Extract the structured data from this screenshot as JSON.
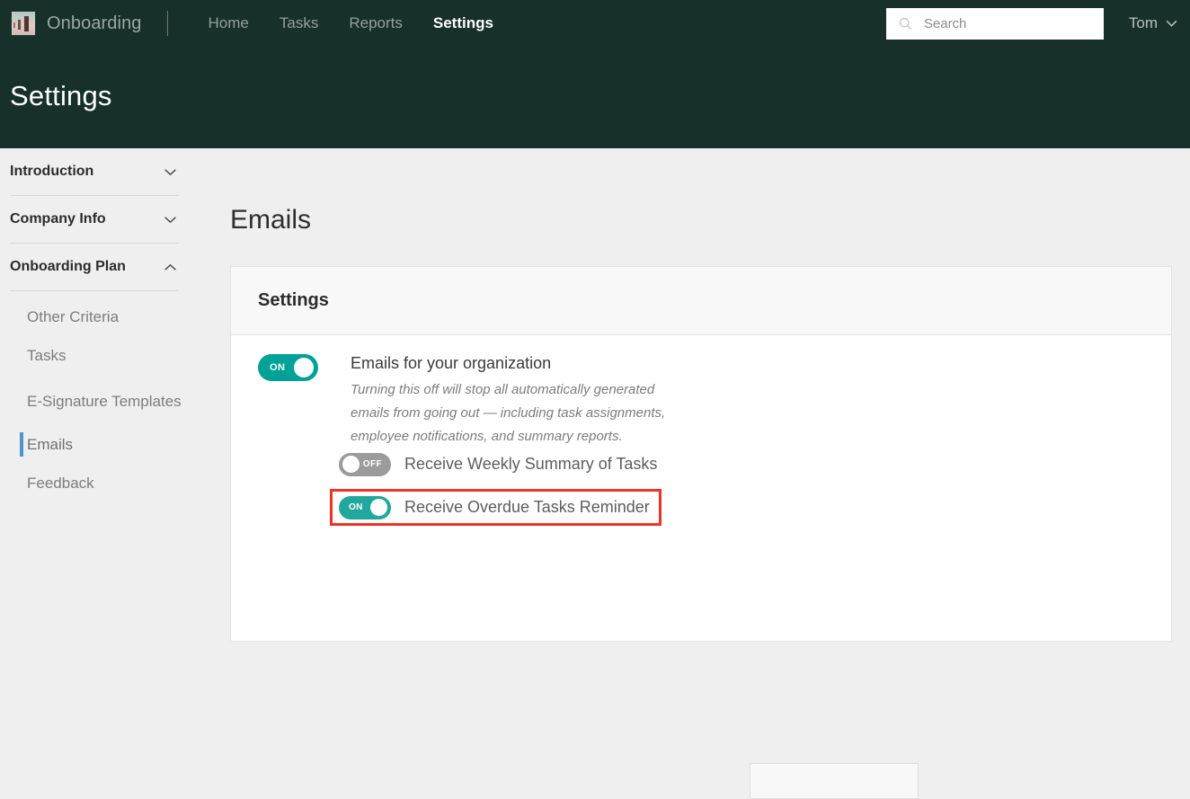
{
  "topnav": {
    "brand_name": "Onboarding",
    "logo_icon": "photo-thumbnail-icon",
    "links": [
      {
        "label": "Home",
        "active": false
      },
      {
        "label": "Tasks",
        "active": false
      },
      {
        "label": "Reports",
        "active": false
      },
      {
        "label": "Settings",
        "active": true
      }
    ],
    "search": {
      "icon": "search-icon",
      "value": "",
      "placeholder": "Search"
    },
    "user": {
      "name": "Tom",
      "chevron_icon": "chevron-down-icon"
    }
  },
  "page_header": {
    "title": "Settings"
  },
  "sidebar": {
    "groups": [
      {
        "label": "Introduction",
        "expanded": false,
        "chevron_icon": "chevron-down-icon"
      },
      {
        "label": "Company Info",
        "expanded": false,
        "chevron_icon": "chevron-down-icon"
      },
      {
        "label": "Onboarding Plan",
        "expanded": true,
        "chevron_icon": "chevron-up-icon"
      }
    ],
    "sub_items": [
      {
        "label": "Other Criteria",
        "active": false
      },
      {
        "label": "Tasks",
        "active": false
      },
      {
        "label": "E-Signature Templates",
        "active": false
      },
      {
        "label": "Emails",
        "active": true
      },
      {
        "label": "Feedback",
        "active": false
      }
    ]
  },
  "main": {
    "title": "Emails",
    "card": {
      "header": "Settings",
      "master_toggle": {
        "state": "ON",
        "label": "Emails for your organization",
        "description": "Turning this off will stop all automatically generated emails from going out — including task assignments, employee notifications, and summary reports."
      },
      "sub_toggles": [
        {
          "state": "OFF",
          "label": "Receive Weekly Summary of Tasks",
          "highlighted": false
        },
        {
          "state": "ON",
          "label": "Receive Overdue Tasks Reminder",
          "highlighted": true
        }
      ]
    }
  },
  "colors": {
    "header_green": "#17302a",
    "toggle_on_teal": "#00a297",
    "toggle_off_gray": "#9b9b9b",
    "highlight_red": "#f03224",
    "active_item_blue": "#4e95cc",
    "page_background": "#efefef"
  }
}
